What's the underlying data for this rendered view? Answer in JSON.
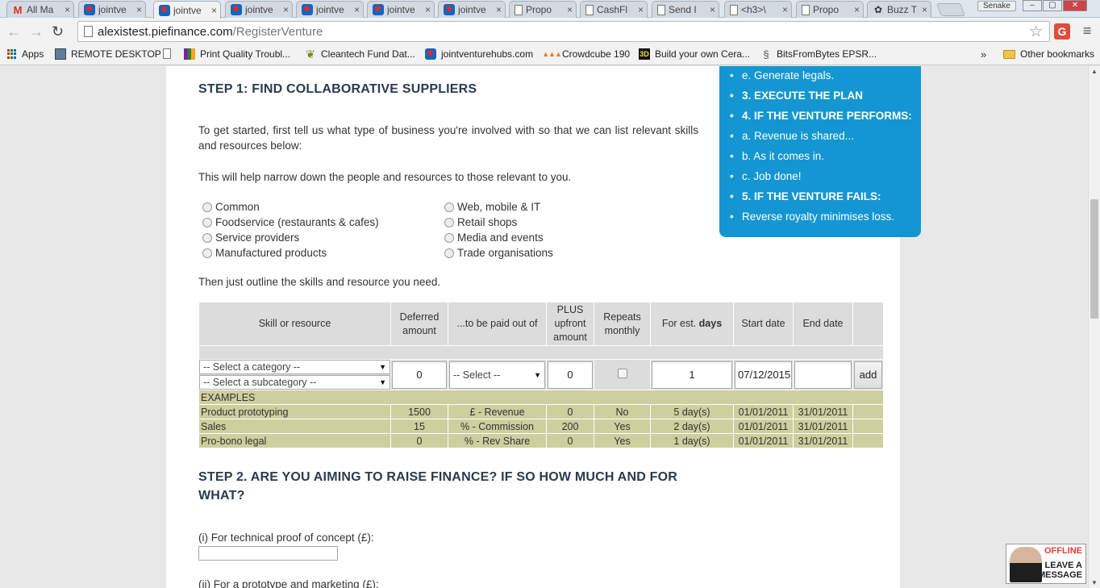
{
  "browser": {
    "tabs": [
      {
        "icon": "gmail",
        "title": "All Ma"
      },
      {
        "icon": "jointventure",
        "title": "jointve"
      },
      {
        "icon": "jointventure",
        "title": "jointve"
      },
      {
        "icon": "jointventure",
        "title": "jointve"
      },
      {
        "icon": "jointventure",
        "title": "jointve"
      },
      {
        "icon": "jointventure",
        "title": "jointve"
      },
      {
        "icon": "jointventure",
        "title": "jointve"
      },
      {
        "icon": "document",
        "title": "Propo"
      },
      {
        "icon": "document",
        "title": "CashFl"
      },
      {
        "icon": "document",
        "title": "Send I"
      },
      {
        "icon": "document",
        "title": "<h3>\\"
      },
      {
        "icon": "document",
        "title": "Propo"
      },
      {
        "icon": "buzz",
        "title": "Buzz T"
      }
    ],
    "tab_close": "×",
    "profile_name": "Senake",
    "url_host": "alexistest.piefinance.com",
    "url_path": "/RegisterVenture",
    "extension_label": "G",
    "bookmarks": [
      {
        "icon": "apps",
        "label": "Apps"
      },
      {
        "icon": "remote-desktop",
        "label": "REMOTE DESKTOP"
      },
      {
        "icon": "document",
        "label": ""
      },
      {
        "icon": "bars",
        "label": "Print Quality Troubl..."
      },
      {
        "icon": "leaf",
        "label": "Cleantech Fund Dat..."
      },
      {
        "icon": "jointventure",
        "label": "jointventurehubs.com"
      },
      {
        "icon": "dots",
        "label": "Crowdcube 190"
      },
      {
        "icon": "3d",
        "label": "Build your own Cera..."
      },
      {
        "icon": "coil",
        "label": "BitsFromBytes EPSR..."
      }
    ],
    "bookmarks_more": "»",
    "other_bookmarks": "Other bookmarks"
  },
  "sidebar": {
    "items": [
      {
        "text": "e. Generate legals.",
        "bold": false
      },
      {
        "text": "3. EXECUTE THE PLAN",
        "bold": true
      },
      {
        "text": "4. IF THE VENTURE PERFORMS:",
        "bold": true
      },
      {
        "text": "a. Revenue is shared...",
        "bold": false
      },
      {
        "text": "b. As it comes in.",
        "bold": false
      },
      {
        "text": "c. Job done!",
        "bold": false
      },
      {
        "text": "5. IF THE VENTURE FAILS:",
        "bold": true
      },
      {
        "text": "Reverse royalty minimises loss.",
        "bold": false
      }
    ]
  },
  "step1": {
    "title": "STEP 1: FIND COLLABORATIVE SUPPLIERS",
    "intro": "To get started, first tell us what type of business you're involved with so that we can list relevant skills and resources below:",
    "narrow": "This will help narrow down the people and resources to those relevant to you.",
    "business_types_left": [
      "Common",
      "Foodservice (restaurants & cafes)",
      "Service providers",
      "Manufactured products"
    ],
    "business_types_right": [
      "Web, mobile & IT",
      "Retail shops",
      "Media and events",
      "Trade organisations"
    ],
    "outline": "Then just outline the skills and resource you need."
  },
  "skills_table": {
    "headers": {
      "skill": "Skill or resource",
      "deferred": "Deferred amount",
      "paid_out_of": "...to be paid out of",
      "upfront": "PLUS upfront amount",
      "repeats": "Repeats monthly",
      "days_prefix": "For est. ",
      "days_bold": "days",
      "start": "Start date",
      "end": "End date"
    },
    "input_row": {
      "category_placeholder": "-- Select a category --",
      "subcategory_placeholder": "-- Select a subcategory --",
      "deferred": "0",
      "paid_out_of": "-- Select --",
      "upfront": "0",
      "days": "1",
      "start_date": "07/12/2015",
      "end_date": "",
      "add_label": "add"
    },
    "examples_label": "EXAMPLES",
    "examples": [
      {
        "skill": "Product prototyping",
        "deferred": "1500",
        "paid_out_of": "£ - Revenue",
        "upfront": "0",
        "repeats": "No",
        "days": "5 day(s)",
        "start": "01/01/2011",
        "end": "31/01/2011"
      },
      {
        "skill": "Sales",
        "deferred": "15",
        "paid_out_of": "% - Commission",
        "upfront": "200",
        "repeats": "Yes",
        "days": "2 day(s)",
        "start": "01/01/2011",
        "end": "31/01/2011"
      },
      {
        "skill": "Pro-bono legal",
        "deferred": "0",
        "paid_out_of": "% - Rev Share",
        "upfront": "0",
        "repeats": "Yes",
        "days": "1 day(s)",
        "start": "01/01/2011",
        "end": "31/01/2011"
      }
    ]
  },
  "step2": {
    "title_line1": "STEP 2. ARE YOU AIMING TO RAISE FINANCE? IF SO HOW MUCH AND FOR",
    "title_line2": "WHAT?",
    "q1_label": "(i) For technical proof of concept (£):",
    "q1_value": "",
    "q2_label": "(ii) For a prototype and marketing (£):"
  },
  "chat": {
    "status": "OFFLINE",
    "line1": "LEAVE A",
    "line2": "MESSAGE"
  }
}
